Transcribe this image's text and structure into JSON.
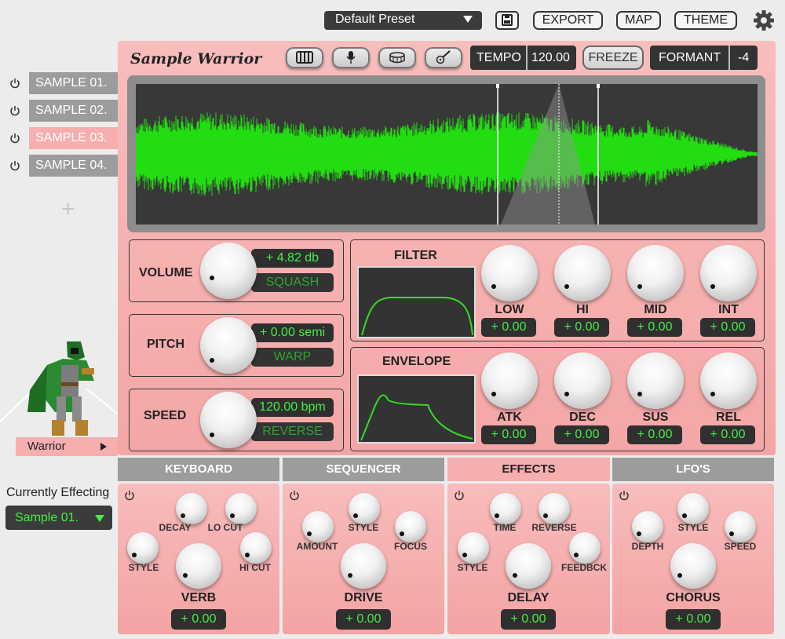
{
  "header": {
    "preset": "Default Preset",
    "export_label": "EXPORT",
    "map_label": "MAP",
    "theme_label": "THEME"
  },
  "app": {
    "title": "Sample Warrior",
    "tempo_label": "TEMPO",
    "tempo_value": "120.00",
    "freeze_label": "FREEZE",
    "formant_label": "FORMANT",
    "formant_value": "-4"
  },
  "colors": {
    "accent": "#f6aeae",
    "waveform": "#22dd11",
    "display_text": "#44ee44"
  },
  "icons": [
    "piano-icon",
    "microphone-icon",
    "drum-icon",
    "guitar-icon",
    "save-icon",
    "gear-icon",
    "power-icon"
  ],
  "samples": [
    {
      "label": "SAMPLE 01.",
      "active": false
    },
    {
      "label": "SAMPLE 02.",
      "active": false
    },
    {
      "label": "SAMPLE 03.",
      "active": true
    },
    {
      "label": "SAMPLE 04.",
      "active": false
    }
  ],
  "controls": {
    "volume": {
      "label": "VOLUME",
      "value": "+ 4.82 db",
      "mode": "SQUASH"
    },
    "pitch": {
      "label": "PITCH",
      "value": "+ 0.00 semi",
      "mode": "WARP"
    },
    "speed": {
      "label": "SPEED",
      "value": "120.00 bpm",
      "mode": "REVERSE"
    }
  },
  "filter": {
    "title": "FILTER",
    "knobs": [
      {
        "label": "LOW",
        "value": "+ 0.00"
      },
      {
        "label": "HI",
        "value": "+ 0.00"
      },
      {
        "label": "MID",
        "value": "+ 0.00"
      },
      {
        "label": "INT",
        "value": "+ 0.00"
      }
    ]
  },
  "envelope": {
    "title": "ENVELOPE",
    "knobs": [
      {
        "label": "ATK",
        "value": "+ 0.00"
      },
      {
        "label": "DEC",
        "value": "+ 0.00"
      },
      {
        "label": "SUS",
        "value": "+ 0.00"
      },
      {
        "label": "REL",
        "value": "+ 0.00"
      }
    ]
  },
  "character": {
    "name": "Warrior"
  },
  "effecting": {
    "label": "Currently Effecting",
    "selected": "Sample 01."
  },
  "tabs": [
    {
      "label": "KEYBOARD",
      "active": false
    },
    {
      "label": "SEQUENCER",
      "active": false
    },
    {
      "label": "EFFECTS",
      "active": true
    },
    {
      "label": "LFO'S",
      "active": false
    }
  ],
  "effects": [
    {
      "name": "VERB",
      "value": "+ 0.00",
      "small": [
        "DECAY",
        "LO CUT",
        "STYLE",
        "HI CUT"
      ]
    },
    {
      "name": "DRIVE",
      "value": "+ 0.00",
      "small": [
        "STYLE",
        "AMOUNT",
        "FOCUS"
      ]
    },
    {
      "name": "DELAY",
      "value": "+ 0.00",
      "small": [
        "TIME",
        "REVERSE",
        "STYLE",
        "FEEDBCK"
      ]
    },
    {
      "name": "CHORUS",
      "value": "+ 0.00",
      "small": [
        "STYLE",
        "DEPTH",
        "SPEED"
      ]
    }
  ]
}
